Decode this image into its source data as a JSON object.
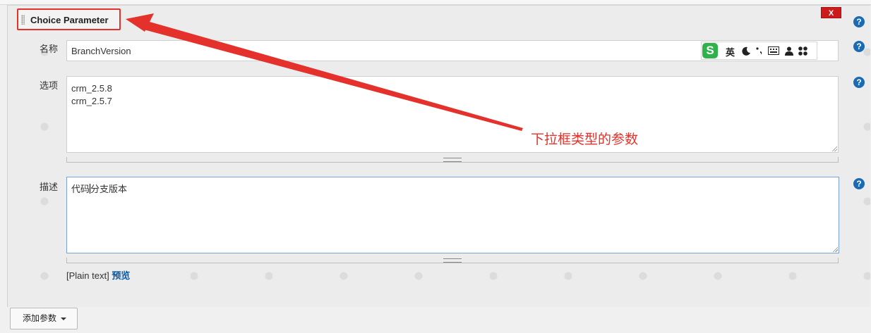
{
  "parameter": {
    "header_title": "Choice Parameter",
    "delete_label": "X"
  },
  "help_icon_glyph": "?",
  "fields": {
    "name": {
      "label": "名称",
      "value": "BranchVersion"
    },
    "choices": {
      "label": "选项",
      "lines": [
        "crm_2.5.8",
        "crm_2.5.7"
      ]
    },
    "description": {
      "label": "描述",
      "value_before_cursor": "代码",
      "value_after_cursor": "分支版本"
    }
  },
  "ime_toolbar": {
    "logo": "S",
    "mode": "英",
    "icons": [
      "moon-icon",
      "punctuation-icon",
      "keyboard-icon",
      "user-icon",
      "grid-icon"
    ]
  },
  "description_footer": {
    "format": "[Plain text]",
    "preview_label": "预览"
  },
  "annotation": {
    "text": "下拉框类型的参数"
  },
  "add_parameter_button": {
    "label": "添加参数"
  },
  "colors": {
    "annotation_red": "#e4312b",
    "help_blue": "#1a6ab4",
    "delete_red": "#cc1b1b",
    "link_blue": "#0b5aa8",
    "ime_green": "#2fb24a"
  }
}
